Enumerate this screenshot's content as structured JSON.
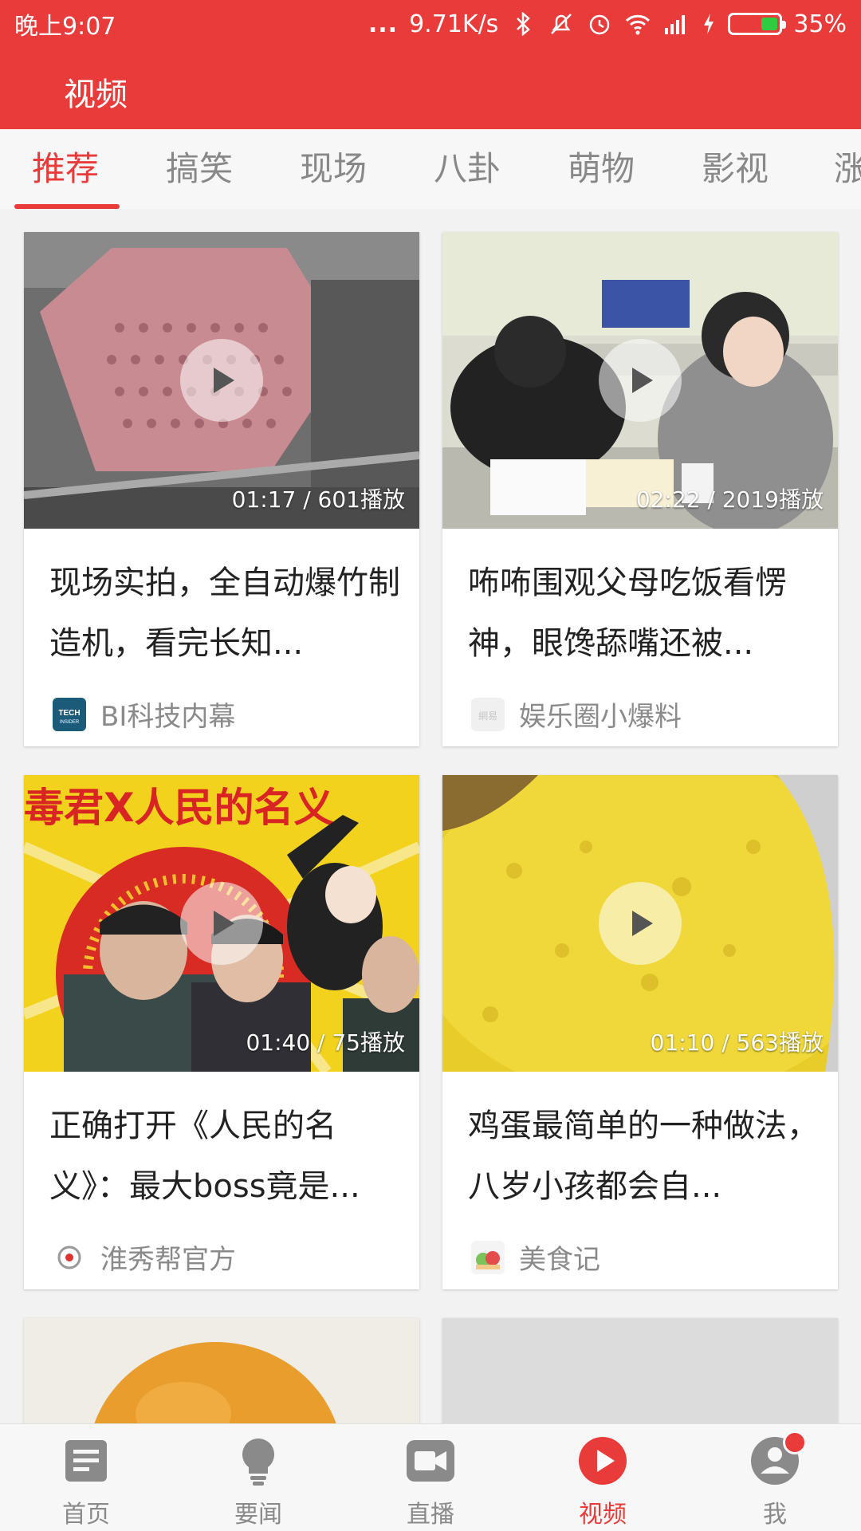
{
  "status": {
    "time": "晚上9:07",
    "dots": "...",
    "network_speed": "9.71K/s",
    "battery": "35%",
    "battery_level": 0.35,
    "icons": [
      "bluetooth-icon",
      "mute-icon",
      "alarm-icon",
      "wifi-icon",
      "signal-icon",
      "charging-icon",
      "battery-icon"
    ]
  },
  "header": {
    "title": "视频"
  },
  "tabs": [
    {
      "label": "推荐",
      "active": true
    },
    {
      "label": "搞笑"
    },
    {
      "label": "现场"
    },
    {
      "label": "八卦"
    },
    {
      "label": "萌物"
    },
    {
      "label": "影视"
    },
    {
      "label": "涨"
    }
  ],
  "videos": [
    {
      "duration": "01:17 / 601播放",
      "title": "现场实拍，全自动爆竹制造机，看完长知...",
      "source": "BI科技内幕"
    },
    {
      "duration": "02:22 / 2019播放",
      "title": "咘咘围观父母吃饭看愣神，眼馋舔嘴还被...",
      "source": "娱乐圈小爆料"
    },
    {
      "duration": "01:40 / 75播放",
      "title": "正确打开《人民的名义》：最大boss竟是...",
      "source": "淮秀帮官方"
    },
    {
      "duration": "01:10 / 563播放",
      "title": "鸡蛋最简单的一种做法，八岁小孩都会自...",
      "source": "美食记"
    }
  ],
  "thumb_text": {
    "poster_banner": "毒君X人民的名义",
    "tech_logo": "TECH",
    "tech_logo_sub": "INSIDER",
    "netease_logo": "網易"
  },
  "bottom_nav": [
    {
      "label": "首页",
      "icon": "news-icon"
    },
    {
      "label": "要闻",
      "icon": "lightbulb-icon"
    },
    {
      "label": "直播",
      "icon": "video-camera-icon"
    },
    {
      "label": "视频",
      "icon": "play-circle-icon",
      "active": true
    },
    {
      "label": "我",
      "icon": "user-icon",
      "badge": true
    }
  ],
  "colors": {
    "brand": "#ea3b3b",
    "text": "#222222",
    "muted": "#8a8a8a",
    "background": "#f2f2f2"
  }
}
